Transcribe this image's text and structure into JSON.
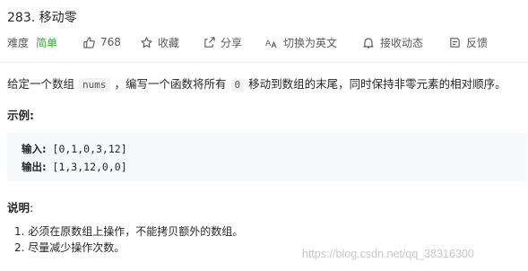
{
  "problem": {
    "title": "283. 移动零"
  },
  "toolbar": {
    "difficulty_label": "难度",
    "difficulty_value": "简单",
    "likes": "768",
    "favorite_label": "收藏",
    "share_label": "分享",
    "translate_label": "切换为英文",
    "notify_label": "接收动态",
    "feedback_label": "反馈",
    "icons": [
      "thumbs-up-icon",
      "star-icon",
      "share-icon",
      "translate-icon",
      "bell-icon",
      "feedback-icon"
    ],
    "colors": {
      "difficulty": "#43a047",
      "muted": "#595959"
    }
  },
  "description": {
    "part1": "给定一个数组",
    "code1": "nums",
    "part2": "，编写一个函数将所有",
    "code2": "0",
    "part3": "移动到数组的末尾，同时保持非零元素的相对顺序。"
  },
  "example": {
    "title": "示例:",
    "input_label": "输入:",
    "input_value": " [0,1,0,3,12]",
    "output_label": "输出:",
    "output_value": " [1,3,12,0,0]"
  },
  "notes": {
    "title": "说明",
    "colon": ":",
    "items": [
      "1. 必须在原数组上操作，不能拷贝额外的数组。",
      "2. 尽量减少操作次数。"
    ]
  },
  "watermark": "https://blog.csdn.net/qq_38316300"
}
